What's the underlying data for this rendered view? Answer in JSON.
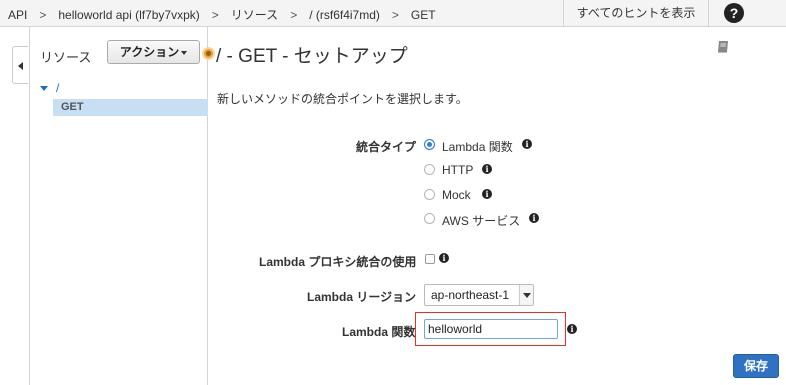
{
  "breadcrumb": {
    "items": [
      "API",
      "helloworld api (lf7by7vxpk)",
      "リソース",
      "/ (rsf6f4i7md)",
      "GET"
    ],
    "separator": ">"
  },
  "header": {
    "hints_label": "すべてのヒントを表示",
    "help_glyph": "?"
  },
  "sidebar": {
    "resources_label": "リソース",
    "actions_label": "アクション",
    "tree_root": "/",
    "tree_selected": "GET"
  },
  "main": {
    "title": "/ - GET - セットアップ",
    "subtitle": "新しいメソッドの統合ポイントを選択します。",
    "integration_type_label": "統合タイプ",
    "integration_options": [
      "Lambda 関数",
      "HTTP",
      "Mock",
      "AWS サービス"
    ],
    "selected_integration": "Lambda 関数",
    "proxy_label": "Lambda プロキシ統合の使用",
    "proxy_checked": false,
    "region_label": "Lambda リージョン",
    "region_value": "ap-northeast-1",
    "function_label": "Lambda 関数",
    "function_value": "helloworld",
    "save_label": "保存",
    "info_glyph": "i"
  },
  "colors": {
    "accent": "#2f72c4",
    "highlight_border": "#e0322a",
    "selected_row": "#c7dff3",
    "status_dot": "#e8a232"
  }
}
